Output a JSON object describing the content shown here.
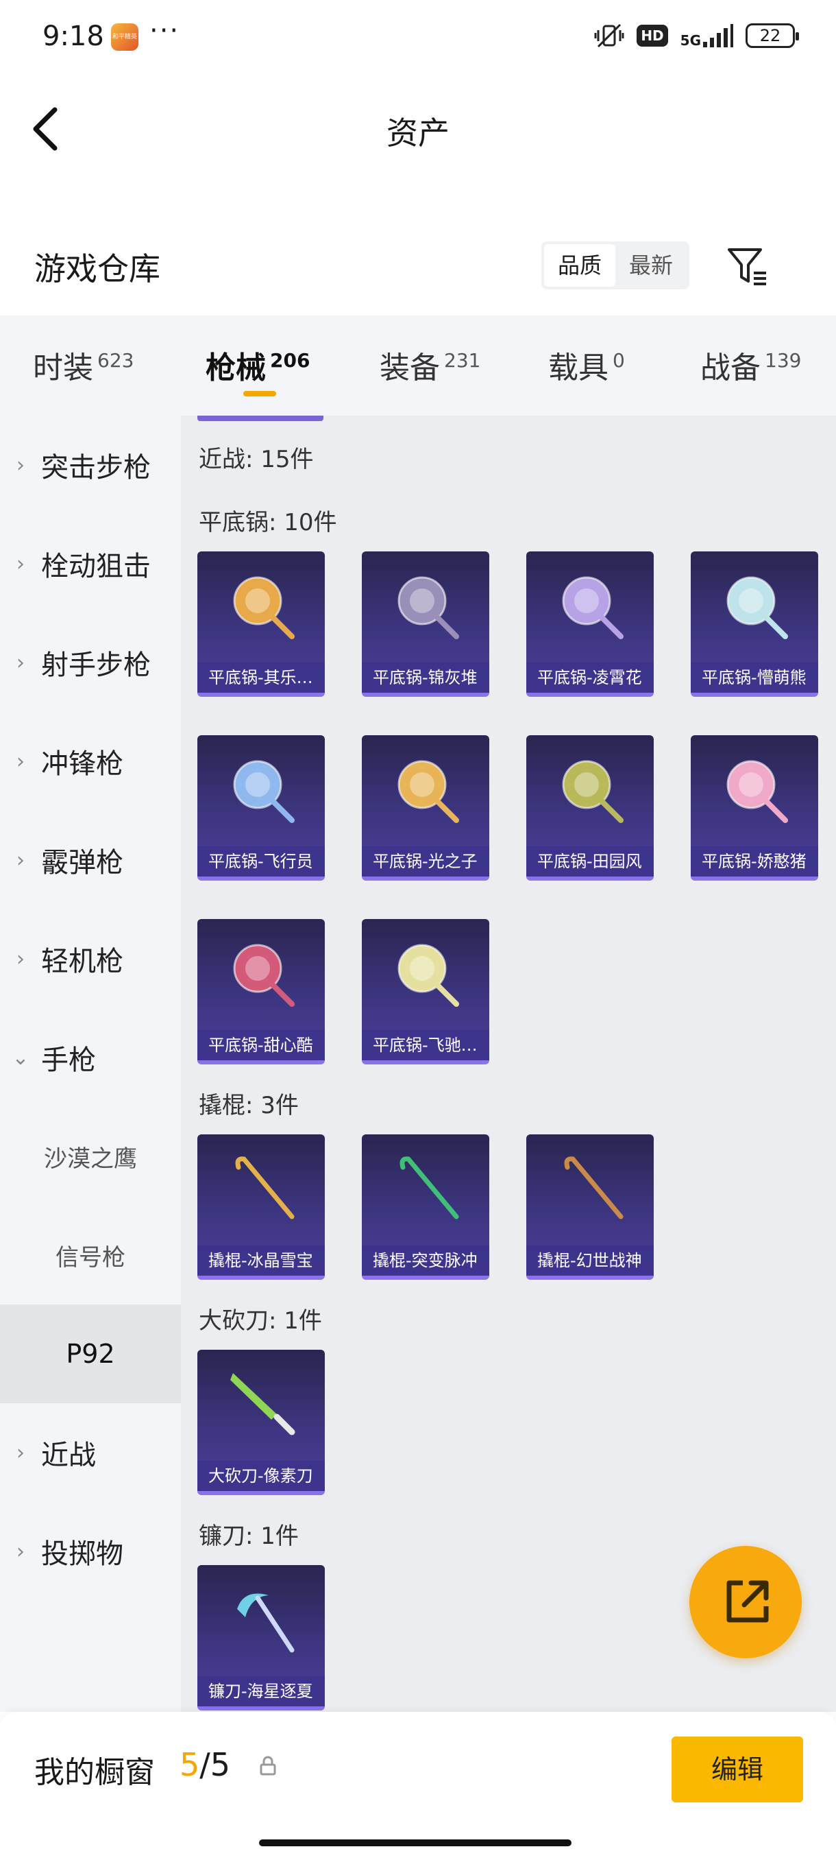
{
  "status_bar": {
    "time": "9:18",
    "app_icon_text": "和平精英",
    "more": "···",
    "hd": "HD",
    "network": "5G",
    "battery": "22"
  },
  "nav": {
    "title": "资产"
  },
  "section": {
    "title": "游戏仓库",
    "sort_options": [
      "品质",
      "最新"
    ],
    "active_sort": "品质"
  },
  "tabs": [
    {
      "label": "时装",
      "count": "623"
    },
    {
      "label": "枪械",
      "count": "206"
    },
    {
      "label": "装备",
      "count": "231"
    },
    {
      "label": "载具",
      "count": "0"
    },
    {
      "label": "战备",
      "count": "139"
    }
  ],
  "sidebar": {
    "items": [
      {
        "label": "突击步枪",
        "chevron": "›"
      },
      {
        "label": "栓动狙击",
        "chevron": "›"
      },
      {
        "label": "射手步枪",
        "chevron": "›"
      },
      {
        "label": "冲锋枪",
        "chevron": "›"
      },
      {
        "label": "霰弹枪",
        "chevron": "›"
      },
      {
        "label": "轻机枪",
        "chevron": "›"
      },
      {
        "label": "手枪",
        "chevron": "⌄"
      },
      {
        "label": "沙漠之鹰"
      },
      {
        "label": "信号枪"
      },
      {
        "label": "P92"
      },
      {
        "label": "近战",
        "chevron": "›"
      },
      {
        "label": "投掷物",
        "chevron": "›"
      }
    ]
  },
  "content": {
    "melee_total": "近战: 15件",
    "groups": [
      {
        "label": "平底锅: 10件",
        "items": [
          {
            "name": "平底锅-其乐融融",
            "color": "#e7a94a"
          },
          {
            "name": "平底锅-锦灰堆",
            "color": "#9a8fb8"
          },
          {
            "name": "平底锅-凌霄花",
            "color": "#b7a2e6"
          },
          {
            "name": "平底锅-懵萌熊",
            "color": "#bfe3ea"
          },
          {
            "name": "平底锅-飞行员",
            "color": "#8fb8ee"
          },
          {
            "name": "平底锅-光之子",
            "color": "#e7b458"
          },
          {
            "name": "平底锅-田园风",
            "color": "#b9b95a"
          },
          {
            "name": "平底锅-娇憨猪",
            "color": "#f0a9c6"
          },
          {
            "name": "平底锅-甜心酷",
            "color": "#d45a7a"
          },
          {
            "name": "平底锅-飞驰人生",
            "color": "#e6e0a0"
          }
        ]
      },
      {
        "label": "撬棍: 3件",
        "items": [
          {
            "name": "撬棍-冰晶雪宝",
            "color": "#e3b04a"
          },
          {
            "name": "撬棍-突变脉冲",
            "color": "#3fbf77"
          },
          {
            "name": "撬棍-幻世战神",
            "color": "#c98a4a"
          }
        ]
      },
      {
        "label": "大砍刀: 1件",
        "items": [
          {
            "name": "大砍刀-像素刀",
            "color": "#8ed653"
          }
        ]
      },
      {
        "label": "镰刀: 1件",
        "items": [
          {
            "name": "镰刀-海星逐夏",
            "color": "#6fd0e6"
          }
        ]
      }
    ]
  },
  "bottom_bar": {
    "title": "我的橱窗",
    "current": "5",
    "sep": "/",
    "max": "5",
    "edit_label": "编辑"
  }
}
